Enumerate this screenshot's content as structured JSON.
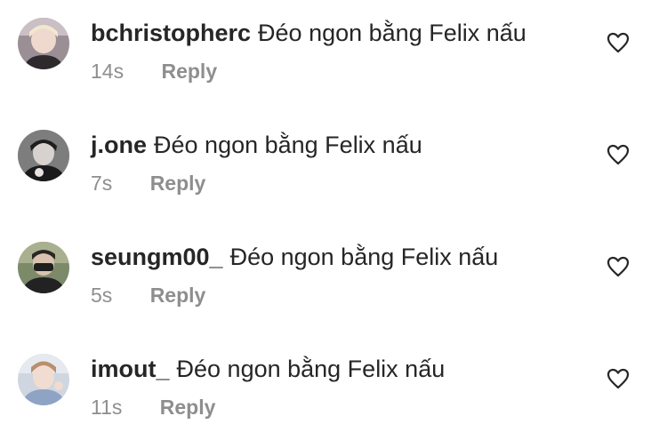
{
  "comments": [
    {
      "username": "bchristopherc",
      "text": "Đéo ngon bằng Felix nấu",
      "time": "14s",
      "reply_label": "Reply",
      "like_icon": "heart-outline-icon"
    },
    {
      "username": "j.one",
      "text": "Đéo ngon bằng Felix nấu",
      "time": "7s",
      "reply_label": "Reply",
      "like_icon": "heart-outline-icon"
    },
    {
      "username": "seungm00_",
      "text": "Đéo ngon bằng Felix nấu",
      "time": "5s",
      "reply_label": "Reply",
      "like_icon": "heart-outline-icon"
    },
    {
      "username": "imout_",
      "text": "Đéo ngon bằng Felix nấu",
      "time": "11s",
      "reply_label": "Reply",
      "like_icon": "heart-outline-icon"
    }
  ],
  "colors": {
    "primary_text": "#262626",
    "secondary_text": "#8e8e8e",
    "background": "#ffffff"
  }
}
